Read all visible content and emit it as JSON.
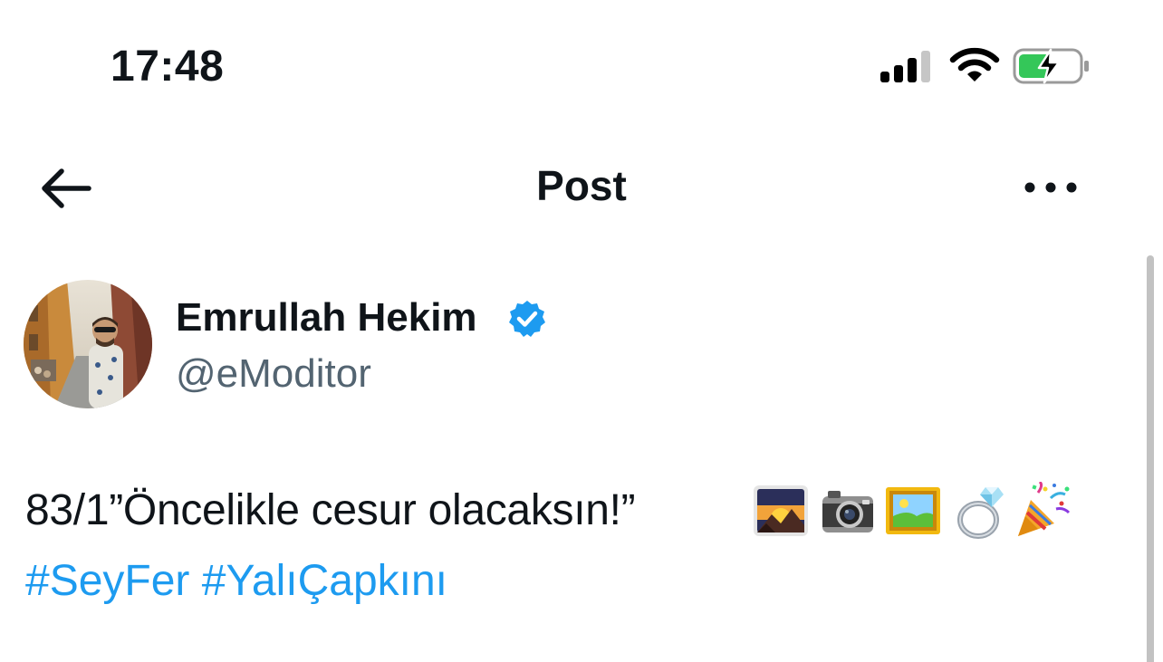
{
  "status_bar": {
    "time": "17:48",
    "icons": [
      "signal-icon",
      "wifi-icon",
      "battery-charging-icon"
    ]
  },
  "header": {
    "title": "Post",
    "back_icon": "arrow-left-icon",
    "more_icon": "more-horizontal-icon"
  },
  "author": {
    "name": "Emrullah Hekim",
    "handle": "@eModitor",
    "verified": true
  },
  "post": {
    "text": "83/1”Öncelikle cesur olacaksın!”",
    "emojis": [
      "sunrise-over-mountains",
      "camera",
      "framed-picture",
      "ring",
      "party-popper"
    ],
    "hashtags": [
      "#SeyFer",
      "#YalıÇapkını"
    ]
  },
  "colors": {
    "link": "#1d9bf0",
    "verified": "#1d9bf0",
    "handle": "#536471",
    "battery": "#34c759"
  }
}
